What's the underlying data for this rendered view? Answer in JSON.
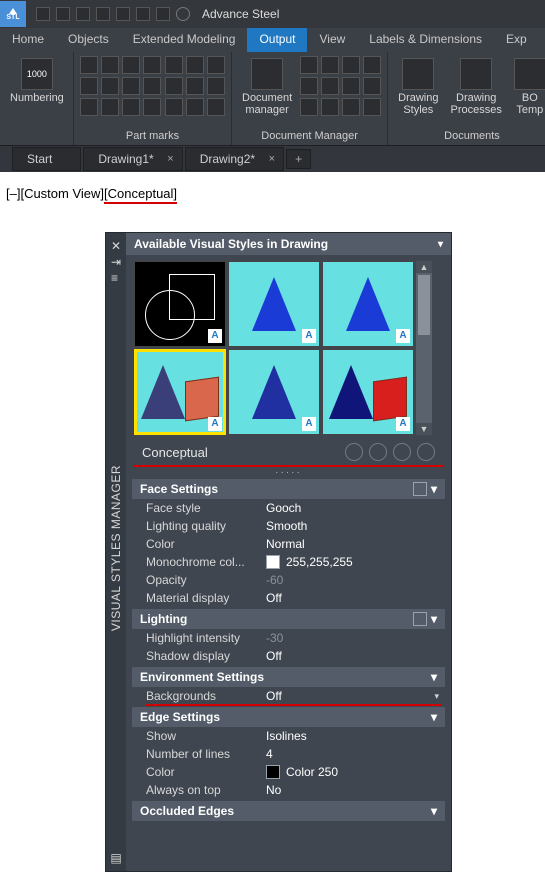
{
  "app": {
    "workspace": "Advance Steel",
    "stl_label": "STL"
  },
  "menu": {
    "home": "Home",
    "objects": "Objects",
    "ext": "Extended Modeling",
    "output": "Output",
    "view": "View",
    "labels": "Labels & Dimensions",
    "exp": "Exp"
  },
  "ribbon": {
    "numbering": "Numbering",
    "numbering_badge": "1000",
    "partmarks": "Part marks",
    "docmgr_btn": "Document\nmanager",
    "docmgr_panel": "Document Manager",
    "drawing_styles": "Drawing\nStyles",
    "drawing_processes": "Drawing\nProcesses",
    "bom": "BO\nTemp",
    "documents": "Documents"
  },
  "doctabs": {
    "start": "Start",
    "d1": "Drawing1*",
    "d2": "Drawing2*"
  },
  "status": {
    "left": "[–][Custom View]",
    "right": "[Conceptual]"
  },
  "palette": {
    "title": "VISUAL STYLES MANAGER",
    "header": "Available Visual Styles in Drawing",
    "selected": "Conceptual"
  },
  "props": {
    "face_settings": "Face Settings",
    "face_style_k": "Face style",
    "face_style_v": "Gooch",
    "lighting_q_k": "Lighting quality",
    "lighting_q_v": "Smooth",
    "color_k": "Color",
    "color_v": "Normal",
    "mono_k": "Monochrome col...",
    "mono_v": "255,255,255",
    "opacity_k": "Opacity",
    "opacity_v": "-60",
    "matdisp_k": "Material display",
    "matdisp_v": "Off",
    "lighting": "Lighting",
    "hl_k": "Highlight intensity",
    "hl_v": "-30",
    "shadow_k": "Shadow display",
    "shadow_v": "Off",
    "env": "Environment Settings",
    "bg_k": "Backgrounds",
    "bg_v": "Off",
    "edge": "Edge Settings",
    "show_k": "Show",
    "show_v": "Isolines",
    "nlines_k": "Number of lines",
    "nlines_v": "4",
    "ecolor_k": "Color",
    "ecolor_v": "Color 250",
    "aot_k": "Always on top",
    "aot_v": "No",
    "occ": "Occluded Edges"
  }
}
